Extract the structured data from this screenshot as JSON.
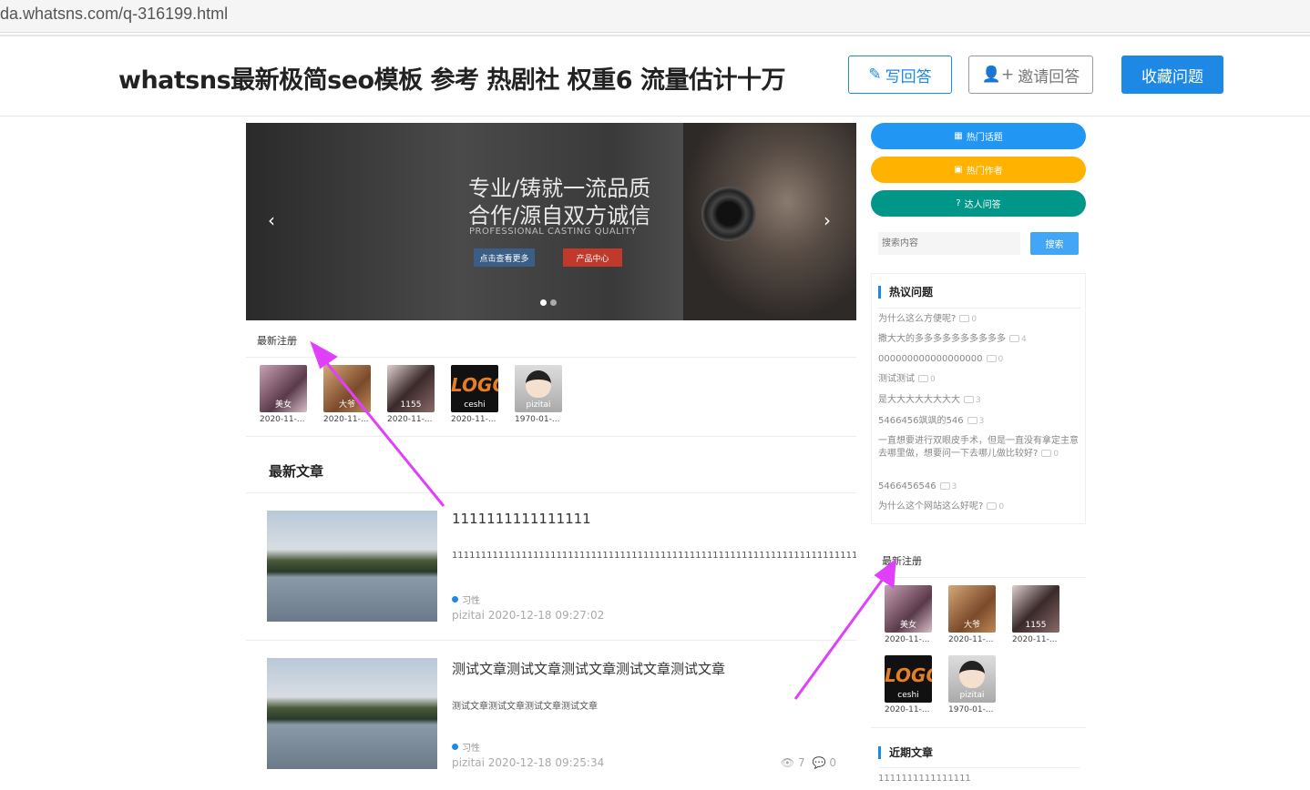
{
  "browser": {
    "url": "da.whatsns.com/q-316199.html"
  },
  "header": {
    "title": "whatsns最新极简seo模板 参考 热剧社 权重6 流量估计十万",
    "answer_label": "写回答",
    "invite_label": "邀请回答",
    "collect_label": "收藏问题"
  },
  "banner": {
    "line1": "专业/铸就一流品质",
    "line2": "合作/源自双方诚信",
    "sub": "PROFESSIONAL CASTING QUALITY",
    "btn_more": "点击查看更多",
    "btn_products": "产品中心",
    "prev": "‹",
    "next": "›"
  },
  "latest_register": {
    "label": "最新注册",
    "users": [
      {
        "name": "美女",
        "date": "2020-11-..."
      },
      {
        "name": "大爷",
        "date": "2020-11-..."
      },
      {
        "name": "1155",
        "date": "2020-11-..."
      },
      {
        "name": "ceshi",
        "date": "2020-11-..."
      },
      {
        "name": "pizitai",
        "date": "1970-01-..."
      }
    ]
  },
  "articles": {
    "title": "最新文章",
    "items": [
      {
        "title": "1111111111111111",
        "desc": "1111111111111111111111111111111111111111111111111111111111111111111111111111111111111111111111",
        "tag": "习性",
        "meta": "pizitai 2020-12-18 09:27:02"
      },
      {
        "title": "测试文章测试文章测试文章测试文章测试文章",
        "desc": "测试文章测试文章测试文章测试文章",
        "tag": "习性",
        "meta": "pizitai 2020-12-18 09:25:34",
        "views": "7",
        "comments": "0"
      }
    ]
  },
  "sidebar": {
    "hot_topics": "热门话题",
    "hot_authors": "热门作者",
    "expert_qa": "达人问答",
    "search_placeholder": "搜索内容",
    "search_button": "搜索",
    "hot_questions_title": "热议问题",
    "hot_questions": [
      {
        "text": "为什么这么方便呢?",
        "count": "0"
      },
      {
        "text": "撒大大的多多多多多多多多多多",
        "count": "4"
      },
      {
        "text": "000000000000000000",
        "count": "0"
      },
      {
        "text": "测试测试",
        "count": "0"
      },
      {
        "text": "是大大大大大大大大",
        "count": "3"
      },
      {
        "text": "5466456飒飒的546",
        "count": "3"
      },
      {
        "text": "一直想要进行双眼皮手术，但是一直没有拿定主意去哪里做，想要问一下去哪儿做比较好?",
        "count": "0"
      },
      {
        "text": "5466456546",
        "count": "3"
      },
      {
        "text": "为什么这个网站这么好呢?",
        "count": "0"
      }
    ],
    "latest_register_label": "最新注册",
    "users": [
      {
        "name": "美女",
        "date": "2020-11-..."
      },
      {
        "name": "大爷",
        "date": "2020-11-..."
      },
      {
        "name": "1155",
        "date": "2020-11-..."
      },
      {
        "name": "ceshi",
        "date": "2020-11-..."
      },
      {
        "name": "pizitai",
        "date": "1970-01-..."
      }
    ],
    "recent_articles_title": "近期文章",
    "recent_articles": [
      "1111111111111111"
    ]
  },
  "colors": {
    "accent": "#1e88e5",
    "annotation": "#e040fb"
  }
}
